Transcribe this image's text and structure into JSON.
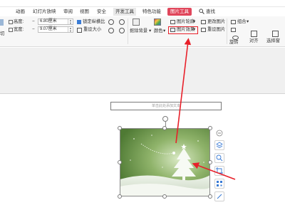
{
  "tabs": [
    {
      "label": "动画"
    },
    {
      "label": "幻灯片放映"
    },
    {
      "label": "审阅"
    },
    {
      "label": "视图"
    },
    {
      "label": "安全"
    },
    {
      "label": "开发工具"
    },
    {
      "label": "特色功能"
    },
    {
      "label": "图片工具"
    },
    {
      "label": "查找"
    }
  ],
  "ribbon": {
    "height_label": "高度:",
    "height_value": "6.80厘米",
    "width_label": "宽度:",
    "width_value": "9.07厘米",
    "lock_ratio_label": "锁定纵横比",
    "reset_size_label": "重设大小",
    "crop_bg_label": "抠除背景",
    "color_label": "颜色",
    "picture_outline_label": "图片轮廓",
    "picture_effects_label": "图片效果",
    "change_picture_label": "更改图片",
    "reset_picture_label": "重设图片",
    "combine_label": "组合",
    "rotate_label": "旋转",
    "align_label": "对齐",
    "selection_pane_label": "选择窗"
  },
  "slide": {
    "textbox_placeholder": "单击此处添加文本"
  },
  "colors": {
    "active_tab": "#e0465b",
    "highlight_red": "#e8202a",
    "picture_green": "#7fa35c"
  }
}
